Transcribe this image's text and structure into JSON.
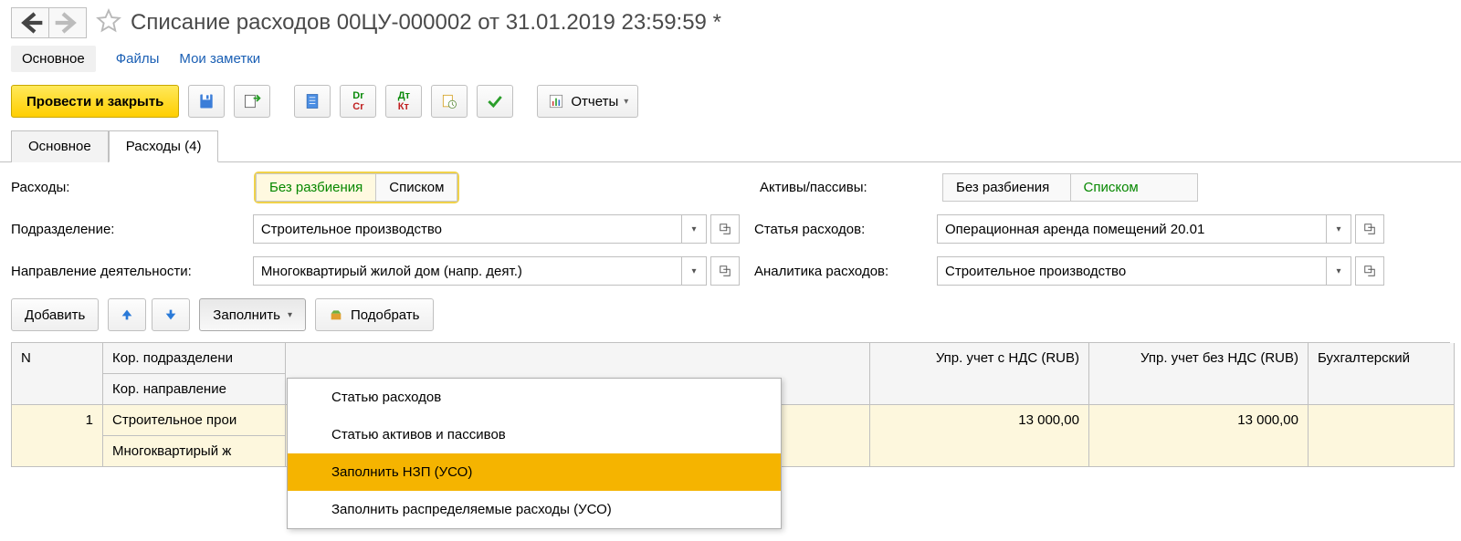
{
  "title": "Списание расходов 00ЦУ-000002 от 31.01.2019 23:59:59 *",
  "sections": {
    "main": "Основное",
    "files": "Файлы",
    "notes": "Мои заметки"
  },
  "commands": {
    "post_close": "Провести и закрыть",
    "reports": "Отчеты"
  },
  "tabs": {
    "main": "Основное",
    "expenses": "Расходы (4)"
  },
  "labels": {
    "expenses": "Расходы:",
    "assets": "Активы/пассивы:",
    "department": "Подразделение:",
    "expense_item": "Статья расходов:",
    "activity": "Направление деятельности:",
    "analytics": "Аналитика расходов:"
  },
  "segments": {
    "no_split": "Без разбиения",
    "list": "Списком"
  },
  "fields": {
    "department": "Строительное производство",
    "expense_item": "Операционная аренда помещений 20.01",
    "activity": "Многоквартирый жилой дом (напр. деят.)",
    "analytics": "Строительное производство"
  },
  "table_tools": {
    "add": "Добавить",
    "fill": "Заполнить",
    "pick": "Подобрать"
  },
  "menu": {
    "i1": "Статью расходов",
    "i2": "Статью активов и пассивов",
    "i3": "Заполнить НЗП (УСО)",
    "i4": "Заполнить распределяемые расходы (УСО)"
  },
  "columns": {
    "n": "N",
    "corr_dept": "Кор. подразделени",
    "corr_dir": "Кор. направление",
    "upr_vat": "Упр. учет с НДС (RUB)",
    "upr_novat": "Упр. учет без НДС (RUB)",
    "accounting": "Бухгалтерский"
  },
  "rows": {
    "r1": {
      "num": "1",
      "dept": "Строительное прои",
      "dir": "Многоквартирый ж",
      "upr_vat": "13 000,00",
      "upr_novat": "13 000,00"
    }
  }
}
